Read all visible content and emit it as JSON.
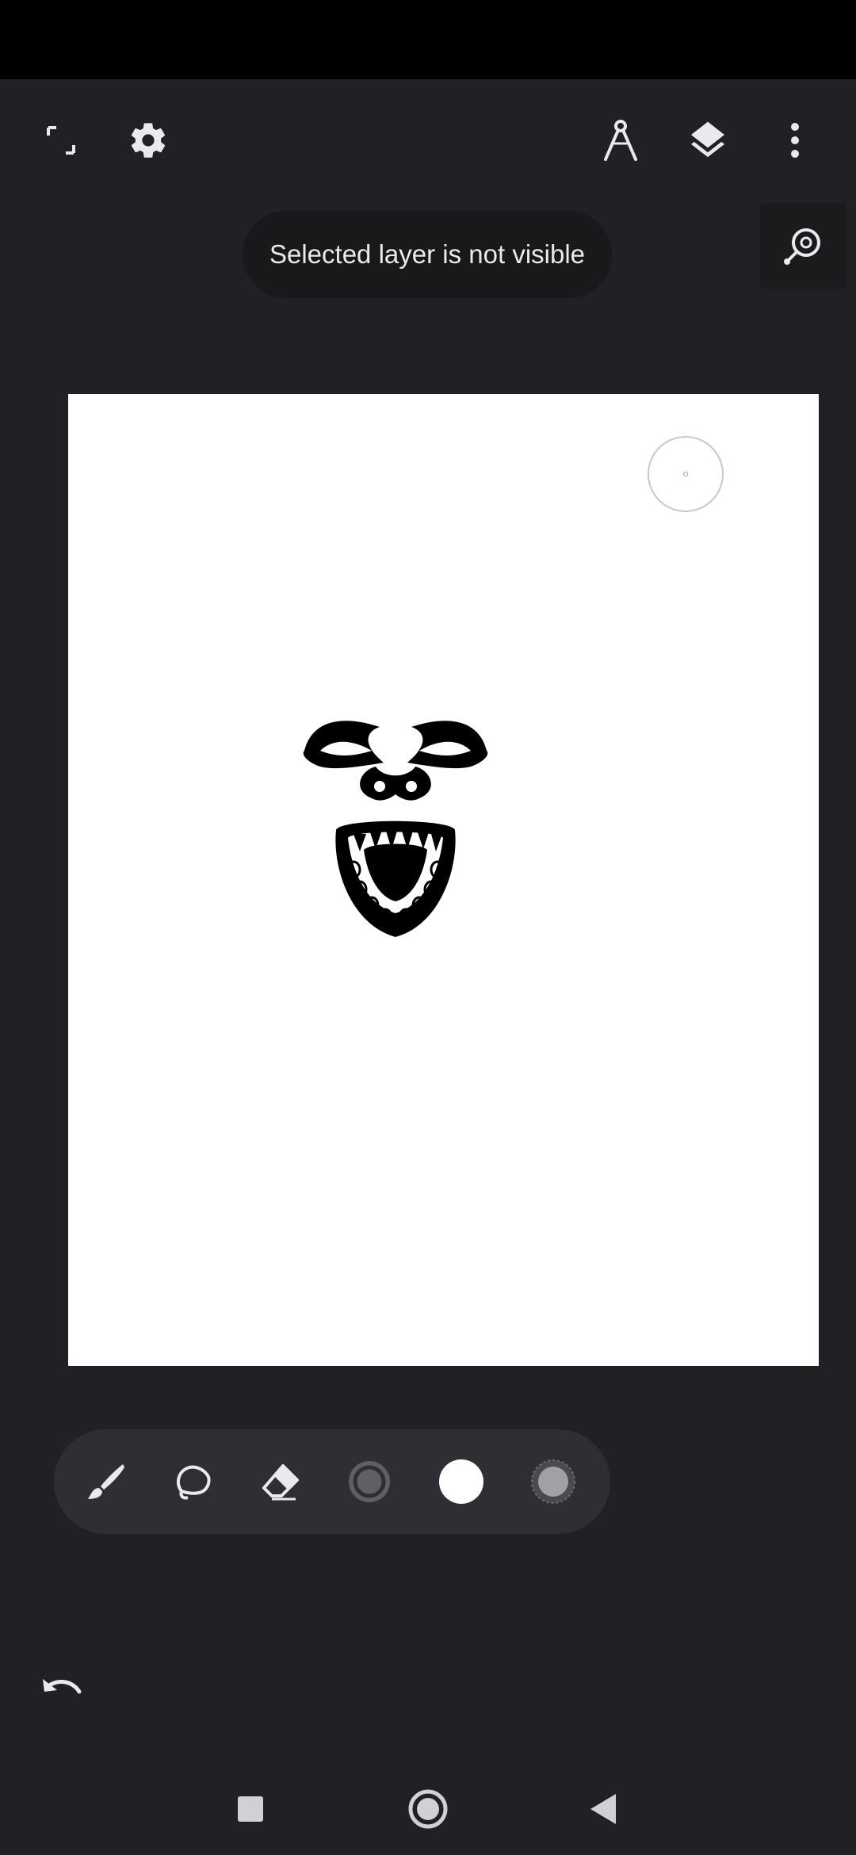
{
  "toast": {
    "message": "Selected layer is not visible"
  },
  "toolbar": {
    "left_icons": [
      "fullscreen-icon",
      "settings-icon"
    ],
    "right_icons": [
      "ruler-compass-icon",
      "layers-icon",
      "more-vert-icon"
    ]
  },
  "reference_button_icon": "reference-zoom-icon",
  "tools": [
    "brush-icon",
    "lasso-icon",
    "eraser-icon",
    "brush-size-icon",
    "color-swatch-icon",
    "opacity-icon"
  ],
  "colors": {
    "background": "#202124",
    "toolbar_pill": "#2e2f32",
    "toast_bg": "#18191b",
    "canvas": "#ffffff",
    "icon": "#e8eaed",
    "current_color": "#ffffff"
  },
  "nav": [
    "recents-icon",
    "home-icon",
    "back-icon"
  ],
  "undo_icon": "undo-icon"
}
